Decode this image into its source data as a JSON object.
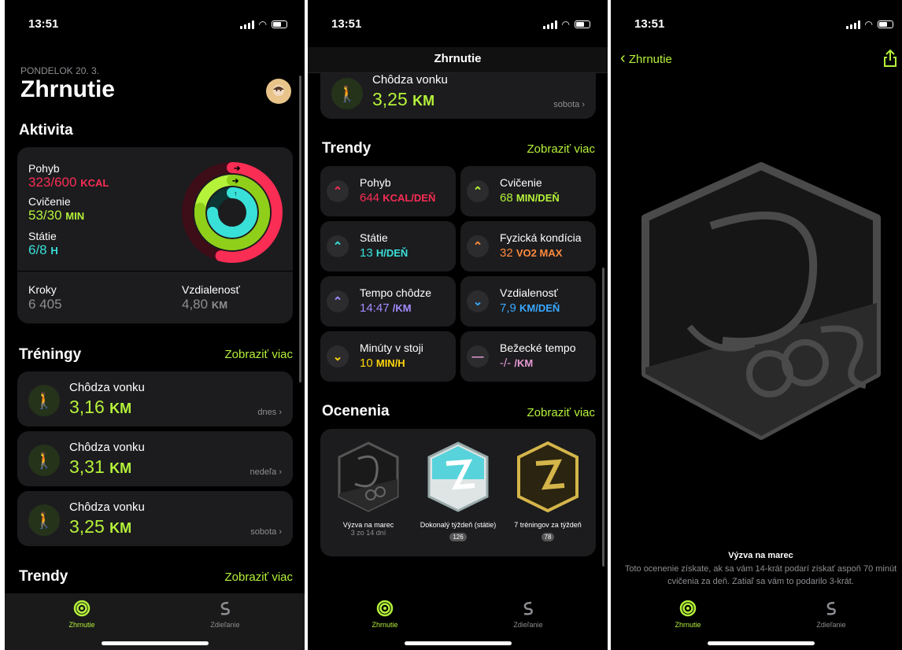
{
  "status": {
    "time": "13:51"
  },
  "screen1": {
    "date": "PONDELOK 20. 3.",
    "title": "Zhrnutie",
    "activity_title": "Aktivita",
    "move": {
      "label": "Pohyb",
      "value": "323/600",
      "unit": "KCAL",
      "color": "#fa2d55"
    },
    "exercise": {
      "label": "Cvičenie",
      "value": "53/30",
      "unit": "MIN",
      "color": "#b5f23a"
    },
    "stand": {
      "label": "Státie",
      "value": "6/8",
      "unit": "H",
      "color": "#38e0d8"
    },
    "steps": {
      "label": "Kroky",
      "value": "6 405"
    },
    "distance": {
      "label": "Vzdialenosť",
      "value": "4,80",
      "unit": "KM"
    },
    "workouts_title": "Tréningy",
    "show_more": "Zobraziť viac",
    "workouts": [
      {
        "name": "Chôdza vonku",
        "value": "3,16",
        "unit": "KM",
        "day": "dnes"
      },
      {
        "name": "Chôdza vonku",
        "value": "3,31",
        "unit": "KM",
        "day": "nedeľa"
      },
      {
        "name": "Chôdza vonku",
        "value": "3,25",
        "unit": "KM",
        "day": "sobota"
      }
    ],
    "trends_title": "Trendy"
  },
  "screen2": {
    "nav_title": "Zhrnutie",
    "partial_workout": {
      "name": "Chôdza vonku",
      "value": "3,25",
      "unit": "KM",
      "day": "sobota"
    },
    "trends_title": "Trendy",
    "show_more": "Zobraziť viac",
    "trends": [
      {
        "name": "Pohyb",
        "value": "644",
        "unit": "KCAL/DEŇ",
        "color": "#fa2d55",
        "dir": "up"
      },
      {
        "name": "Cvičenie",
        "value": "68",
        "unit": "MIN/DEŇ",
        "color": "#b5f23a",
        "dir": "up"
      },
      {
        "name": "Státie",
        "value": "13",
        "unit": "H/DEŇ",
        "color": "#38e0d8",
        "dir": "up"
      },
      {
        "name": "Fyzická kondícia",
        "value": "32",
        "unit": "VO2 MAX",
        "color": "#ff8a3d",
        "dir": "up"
      },
      {
        "name": "Tempo chôdze",
        "value": "14:47",
        "unit": "/KM",
        "color": "#a48cff",
        "dir": "up"
      },
      {
        "name": "Vzdialenosť",
        "value": "7,9",
        "unit": "KM/DEŇ",
        "color": "#3aa8ff",
        "dir": "down"
      },
      {
        "name": "Minúty v stoji",
        "value": "10",
        "unit": "MIN/H",
        "color": "#ffd60a",
        "dir": "down"
      },
      {
        "name": "Bežecké tempo",
        "value": "-/-",
        "unit": "/KM",
        "color": "#e89ad6",
        "dir": "flat"
      }
    ],
    "awards_title": "Ocenenia",
    "awards": [
      {
        "name": "Výzva na marec",
        "sub": "3 zo 14 dní",
        "badge": ""
      },
      {
        "name": "Dokonalý týždeň (státie)",
        "sub": "",
        "badge": "126"
      },
      {
        "name": "7 tréningov za týždeň",
        "sub": "",
        "badge": "78"
      }
    ]
  },
  "screen3": {
    "back_label": "Zhrnutie",
    "award_title": "Výzva na marec",
    "award_desc": "Toto ocenenie získate, ak sa vám 14-krát podarí získať aspoň 70 minút cvičenia za deň. Zatiaľ sa vám to podarilo 3-krát."
  },
  "tabs": {
    "summary": "Zhrnutie",
    "sharing": "Zdieľanie"
  },
  "rings": {
    "move": 0.54,
    "exercise": 1.77,
    "stand": 0.75
  }
}
